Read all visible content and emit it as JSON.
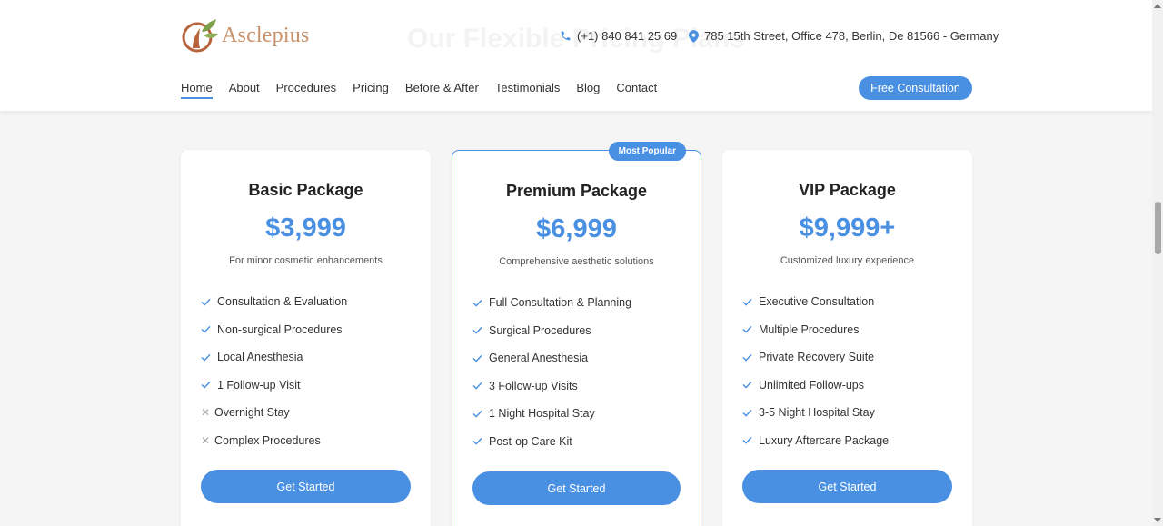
{
  "header": {
    "brand": "Asclepius",
    "ghost_title": "Our Flexible Pricing Plans",
    "phone": "(+1) 840 841 25 69",
    "address": "785 15th Street, Office 478, Berlin, De 81566 - Germany",
    "nav": [
      "Home",
      "About",
      "Procedures",
      "Pricing",
      "Before & After",
      "Testimonials",
      "Blog",
      "Contact"
    ],
    "active_nav": "Home",
    "cta": "Free Consultation"
  },
  "colors": {
    "accent": "#4a90e2",
    "brand": "#c9926b"
  },
  "plans": [
    {
      "name": "Basic Package",
      "price": "$3,999",
      "desc": "For minor cosmetic enhancements",
      "features": [
        {
          "text": "Consultation & Evaluation",
          "included": true
        },
        {
          "text": "Non-surgical Procedures",
          "included": true
        },
        {
          "text": "Local Anesthesia",
          "included": true
        },
        {
          "text": "1 Follow-up Visit",
          "included": true
        },
        {
          "text": "Overnight Stay",
          "included": false
        },
        {
          "text": "Complex Procedures",
          "included": false
        }
      ],
      "button": "Get Started"
    },
    {
      "name": "Premium Package",
      "badge": "Most Popular",
      "price": "$6,999",
      "desc": "Comprehensive aesthetic solutions",
      "features": [
        {
          "text": "Full Consultation & Planning",
          "included": true
        },
        {
          "text": "Surgical Procedures",
          "included": true
        },
        {
          "text": "General Anesthesia",
          "included": true
        },
        {
          "text": "3 Follow-up Visits",
          "included": true
        },
        {
          "text": "1 Night Hospital Stay",
          "included": true
        },
        {
          "text": "Post-op Care Kit",
          "included": true
        }
      ],
      "button": "Get Started"
    },
    {
      "name": "VIP Package",
      "price": "$9,999+",
      "desc": "Customized luxury experience",
      "features": [
        {
          "text": "Executive Consultation",
          "included": true
        },
        {
          "text": "Multiple Procedures",
          "included": true
        },
        {
          "text": "Private Recovery Suite",
          "included": true
        },
        {
          "text": "Unlimited Follow-ups",
          "included": true
        },
        {
          "text": "3-5 Night Hospital Stay",
          "included": true
        },
        {
          "text": "Luxury Aftercare Package",
          "included": true
        }
      ],
      "button": "Get Started"
    }
  ]
}
